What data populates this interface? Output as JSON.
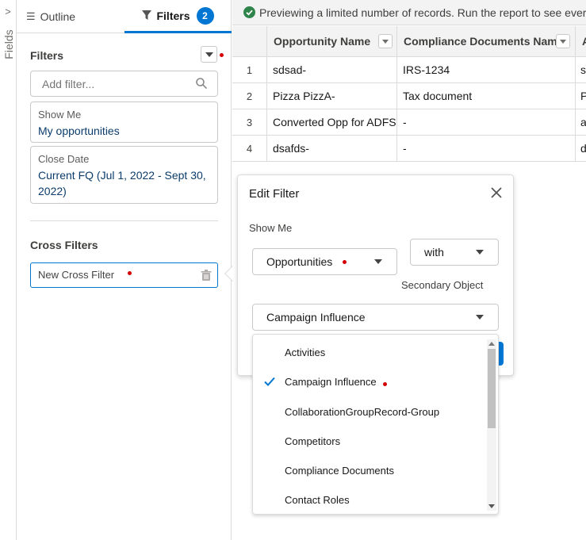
{
  "fields_strip": {
    "label": "Fields",
    "chevron": ">"
  },
  "tabs": {
    "outline": {
      "icon": "list-icon",
      "label": "Outline"
    },
    "filters": {
      "icon": "funnel-icon",
      "label": "Filters",
      "count": "2"
    }
  },
  "filters_panel": {
    "title": "Filters",
    "add_filter_placeholder": "Add filter...",
    "filters": [
      {
        "label": "Show Me",
        "value": "My opportunities"
      },
      {
        "label": "Close Date",
        "value": "Current FQ (Jul 1, 2022 - Sept 30, 2022)"
      }
    ],
    "cross_filters_title": "Cross Filters",
    "cross_filter_item": "New Cross Filter"
  },
  "preview": {
    "message": "Previewing a limited number of records. Run the report to see everything."
  },
  "table": {
    "columns": [
      "Opportunity Name",
      "Compliance Documents Name",
      "A"
    ],
    "rows": [
      {
        "num": "1",
        "cells": [
          "sdsad-",
          "IRS-1234",
          "s"
        ]
      },
      {
        "num": "2",
        "cells": [
          "Pizza PizzA-",
          "Tax document",
          "P"
        ]
      },
      {
        "num": "3",
        "cells": [
          "Converted Opp for ADFSF",
          "-",
          "a"
        ]
      },
      {
        "num": "4",
        "cells": [
          "dsafds-",
          "-",
          "d"
        ]
      }
    ]
  },
  "edit_filter": {
    "title": "Edit Filter",
    "show_me_label": "Show Me",
    "object_value": "Opportunities",
    "with_value": "with",
    "secondary_label": "Secondary Object",
    "secondary_value": "Campaign Influence",
    "options": [
      {
        "label": "Activities",
        "selected": false
      },
      {
        "label": "Campaign Influence",
        "selected": true
      },
      {
        "label": "CollaborationGroupRecord-Group",
        "selected": false
      },
      {
        "label": "Competitors",
        "selected": false
      },
      {
        "label": "Compliance Documents",
        "selected": false
      },
      {
        "label": "Contact Roles",
        "selected": false
      }
    ]
  },
  "colors": {
    "accent": "#0176d3",
    "success": "#2e844a",
    "marker": "#d40000"
  }
}
